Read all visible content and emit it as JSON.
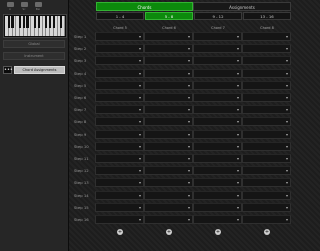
{
  "left_panel": {
    "top_icons": [
      {
        "label": "A",
        "icon": "grid-icon"
      },
      {
        "label": "Sc",
        "icon": "scale-icon"
      },
      {
        "label": "Pan",
        "icon": "pan-icon"
      }
    ],
    "buttons": [
      {
        "label": "Global",
        "active": false
      },
      {
        "label": "Instrument",
        "active": false
      },
      {
        "label": "Chord Assignments",
        "active": true
      }
    ],
    "icon_button": "•••"
  },
  "tabs": {
    "top": [
      {
        "label": "Chords",
        "active": true
      },
      {
        "label": "Assignments",
        "active": false
      }
    ],
    "ranges": [
      {
        "label": "1 - 4",
        "active": false
      },
      {
        "label": "5 - 8",
        "active": true
      },
      {
        "label": "9 - 12",
        "active": false
      },
      {
        "label": "13 - 16",
        "active": false
      }
    ]
  },
  "columns": [
    "Chord 5",
    "Chord 6",
    "Chord 7",
    "Chord 8"
  ],
  "rows": [
    "Step 1",
    "Step 2",
    "Step 3",
    "Step 4",
    "Step 5",
    "Step 6",
    "Step 7",
    "Step 8",
    "Step 9",
    "Step 10",
    "Step 11",
    "Step 12",
    "Step 13",
    "Step 14",
    "Step 15",
    "Step 16"
  ],
  "add_buttons": [
    "+",
    "+",
    "+",
    "+"
  ],
  "colors": {
    "accent": "#0c8a0c",
    "background": "#1b1b1b"
  }
}
